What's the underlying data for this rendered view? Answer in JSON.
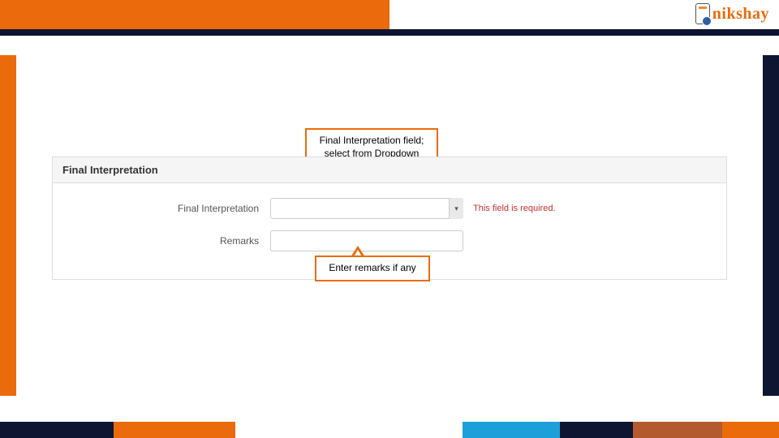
{
  "brand": {
    "name": "nikshay"
  },
  "panel": {
    "title": "Final Interpretation"
  },
  "fields": {
    "interpretation": {
      "label": "Final Interpretation",
      "value": "",
      "error": "This field is required."
    },
    "remarks": {
      "label": "Remarks",
      "value": ""
    }
  },
  "callouts": {
    "top": "Final Interpretation field; select from Dropdown based on test type",
    "bottom": "Enter remarks if any"
  }
}
